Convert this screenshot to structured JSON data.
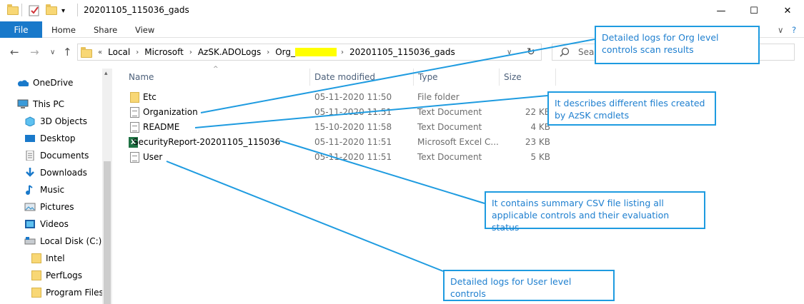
{
  "window": {
    "title": "20201105_115036_gads",
    "controls": {
      "minimize": "—",
      "maximize": "☐",
      "close": "✕"
    }
  },
  "ribbon": {
    "file": "File",
    "tabs": [
      "Home",
      "Share",
      "View"
    ],
    "chevron": "∨",
    "help": "?"
  },
  "address": {
    "crumbs": [
      "Local",
      "Microsoft",
      "AzSK.ADOLogs",
      "Org_",
      "20201105_115036_gads"
    ],
    "overflow": "«",
    "separator": "›",
    "dropdown": "∨",
    "refresh": "↻"
  },
  "search": {
    "placeholder": "Sear"
  },
  "nav": {
    "items": [
      {
        "label": "OneDrive",
        "icon": "cloud-icon"
      },
      {
        "label": "This PC",
        "icon": "computer-icon"
      },
      {
        "label": "3D Objects",
        "icon": "cube-icon"
      },
      {
        "label": "Desktop",
        "icon": "desktop-icon"
      },
      {
        "label": "Documents",
        "icon": "document-icon"
      },
      {
        "label": "Downloads",
        "icon": "download-icon"
      },
      {
        "label": "Music",
        "icon": "music-icon"
      },
      {
        "label": "Pictures",
        "icon": "picture-icon"
      },
      {
        "label": "Videos",
        "icon": "video-icon"
      },
      {
        "label": "Local Disk (C:)",
        "icon": "disk-icon"
      },
      {
        "label": "Intel",
        "icon": "folder-icon"
      },
      {
        "label": "PerfLogs",
        "icon": "folder-icon"
      },
      {
        "label": "Program Files",
        "icon": "folder-icon"
      }
    ]
  },
  "columns": {
    "name": "Name",
    "date": "Date modified",
    "type": "Type",
    "size": "Size"
  },
  "files": [
    {
      "name": "Etc",
      "date": "05-11-2020 11:50",
      "type": "File folder",
      "size": "",
      "icon": "folder-icon"
    },
    {
      "name": "Organization",
      "date": "05-11-2020 11:51",
      "type": "Text Document",
      "size": "22 KB",
      "icon": "text-file-icon"
    },
    {
      "name": "README",
      "date": "15-10-2020 11:58",
      "type": "Text Document",
      "size": "4 KB",
      "icon": "text-file-icon"
    },
    {
      "name": "SecurityReport-20201105_115036",
      "date": "05-11-2020 11:51",
      "type": "Microsoft Excel C...",
      "size": "23 KB",
      "icon": "excel-icon"
    },
    {
      "name": "User",
      "date": "05-11-2020 11:51",
      "type": "Text Document",
      "size": "5 KB",
      "icon": "text-file-icon"
    }
  ],
  "callouts": [
    {
      "text": "Detailed logs for Org level controls scan results"
    },
    {
      "text": "It describes different files created by AzSK cmdlets"
    },
    {
      "text": "It contains summary CSV file listing all applicable controls and their evaluation status"
    },
    {
      "text": "Detailed logs for User level controls"
    }
  ],
  "colors": {
    "accent": "#1979ca",
    "callout": "#1e9be0",
    "redaction": "#ffff00"
  }
}
